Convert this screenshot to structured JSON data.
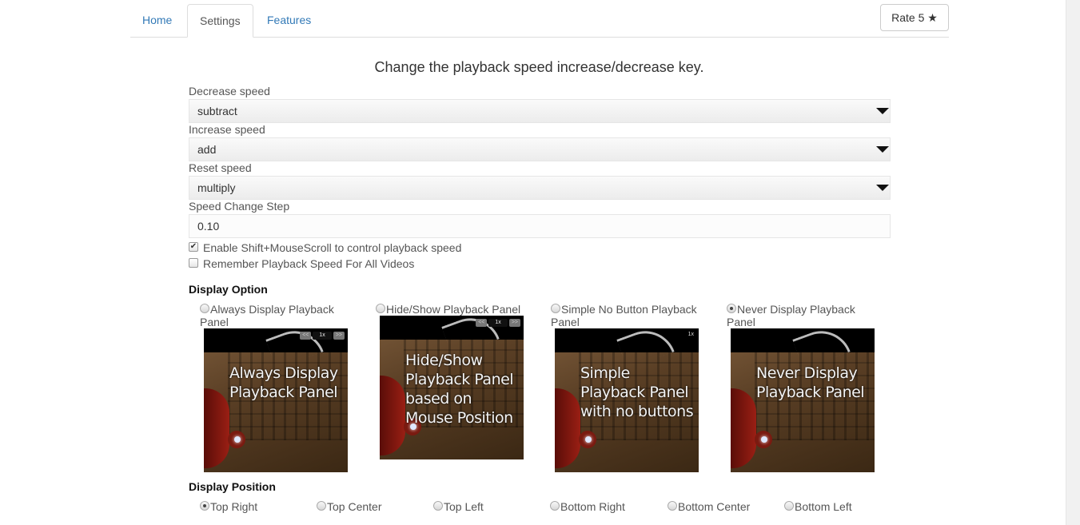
{
  "nav": {
    "tabs": [
      {
        "label": "Home",
        "active": false
      },
      {
        "label": "Settings",
        "active": true
      },
      {
        "label": "Features",
        "active": false
      }
    ],
    "rate_button": "Rate 5 ★"
  },
  "heading": "Change the playback speed increase/decrease key.",
  "fields": {
    "decrease": {
      "label": "Decrease speed",
      "value": "subtract"
    },
    "increase": {
      "label": "Increase speed",
      "value": "add"
    },
    "reset": {
      "label": "Reset speed",
      "value": "multiply"
    },
    "step": {
      "label": "Speed Change Step",
      "value": "0.10"
    }
  },
  "checkboxes": [
    {
      "label": "Enable Shift+MouseScroll to control playback speed",
      "checked": true,
      "mark": "✔"
    },
    {
      "label": "Remember Playback Speed For All Videos",
      "checked": false,
      "mark": ""
    }
  ],
  "display_option": {
    "title": "Display Option",
    "options": [
      {
        "label": "Always Display Playback Panel",
        "selected": false,
        "caption": "Always Display Playback Panel",
        "panel": "full"
      },
      {
        "label": "Hide/Show Playback Panel",
        "selected": false,
        "caption": "Hide/Show Playback Panel based on Mouse Position",
        "panel": "full"
      },
      {
        "label": "Simple No Button Playback Panel",
        "selected": false,
        "caption": "Simple Playback Panel with no buttons",
        "panel": "simple"
      },
      {
        "label": "Never Display Playback Panel",
        "selected": true,
        "caption": "Never Display Playback Panel",
        "panel": "none"
      }
    ],
    "panel": {
      "prev": "<<",
      "speed": "1x",
      "next": ">>"
    }
  },
  "display_position": {
    "title": "Display Position",
    "options": [
      {
        "label": "Top Right",
        "selected": true
      },
      {
        "label": "Top Center",
        "selected": false
      },
      {
        "label": "Top Left",
        "selected": false
      },
      {
        "label": "Bottom Right",
        "selected": false
      },
      {
        "label": "Bottom Center",
        "selected": false
      },
      {
        "label": "Bottom Left",
        "selected": false
      }
    ]
  }
}
